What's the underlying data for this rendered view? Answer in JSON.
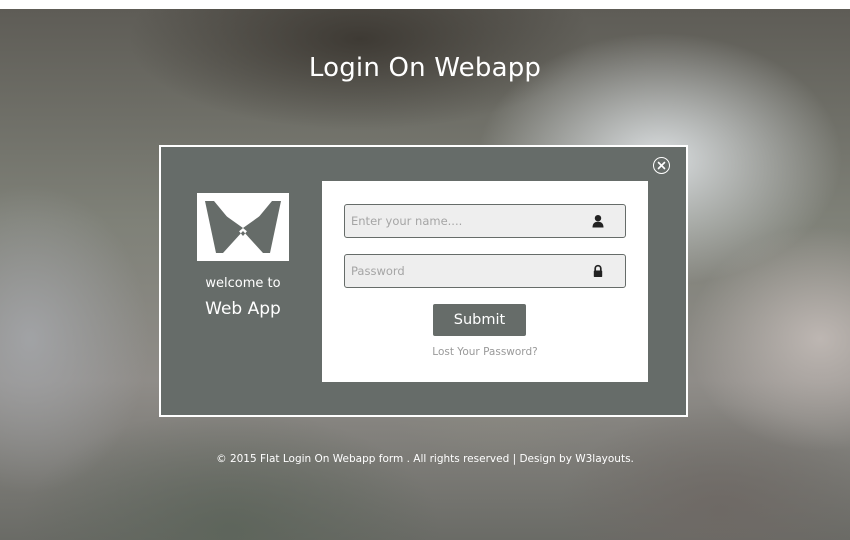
{
  "page": {
    "title": "Login On Webapp"
  },
  "modal": {
    "close_icon": "close-circle-icon",
    "welcome_text": "welcome to",
    "app_name": "Web App",
    "logo_icon": "envelope-icon"
  },
  "form": {
    "name_placeholder": "Enter your name....",
    "name_value": "",
    "name_icon": "user-icon",
    "password_placeholder": "Password",
    "password_value": "",
    "password_icon": "lock-icon",
    "submit_label": "Submit",
    "lost_password_label": "Lost Your Password?"
  },
  "footer": {
    "text": "© 2015 Flat Login On Webapp form . All rights reserved | Design by W3layouts."
  },
  "colors": {
    "modal_background": "#666c69",
    "panel_background": "#ffffff",
    "field_background": "#eeeeee",
    "button_background": "#666c69",
    "text_on_dark": "#ffffff",
    "link_text": "#9a9a9a"
  }
}
